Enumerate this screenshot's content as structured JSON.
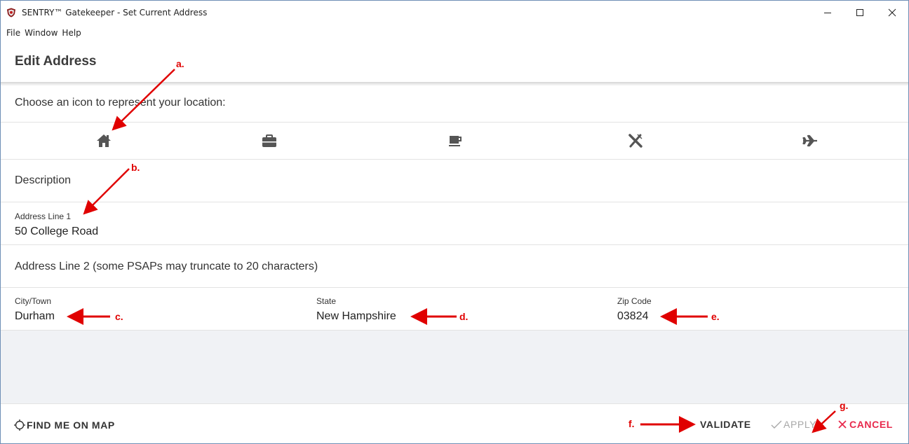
{
  "window": {
    "title": "SENTRY™ Gatekeeper - Set Current Address"
  },
  "menu": {
    "items": [
      "File",
      "Window",
      "Help"
    ]
  },
  "header": {
    "title": "Edit Address"
  },
  "icon_chooser": {
    "prompt": "Choose an icon to represent your location:",
    "icons": [
      "home-icon",
      "briefcase-icon",
      "coffee-cup-icon",
      "utensils-icon",
      "airplane-icon"
    ]
  },
  "fields": {
    "description_placeholder": "Description",
    "address1_label": "Address Line 1",
    "address1_value": "50 College Road",
    "address2_placeholder": "Address Line 2 (some PSAPs may truncate to 20 characters)",
    "city_label": "City/Town",
    "city_value": "Durham",
    "state_label": "State",
    "state_value": "New Hampshire",
    "zip_label": "Zip Code",
    "zip_value": "03824"
  },
  "footer": {
    "find_me": "FIND ME ON MAP",
    "validate": "VALIDATE",
    "apply": "APPLY",
    "cancel": "CANCEL"
  },
  "annotations": {
    "a": "a.",
    "b": "b.",
    "c": "c.",
    "d": "d.",
    "e": "e.",
    "f": "f.",
    "g": "g."
  },
  "colors": {
    "annotation": "#e00000",
    "cancel": "#e8294c",
    "apply_disabled": "#a8a8a8",
    "icon": "#555555",
    "gray_area": "#f0f2f5"
  }
}
